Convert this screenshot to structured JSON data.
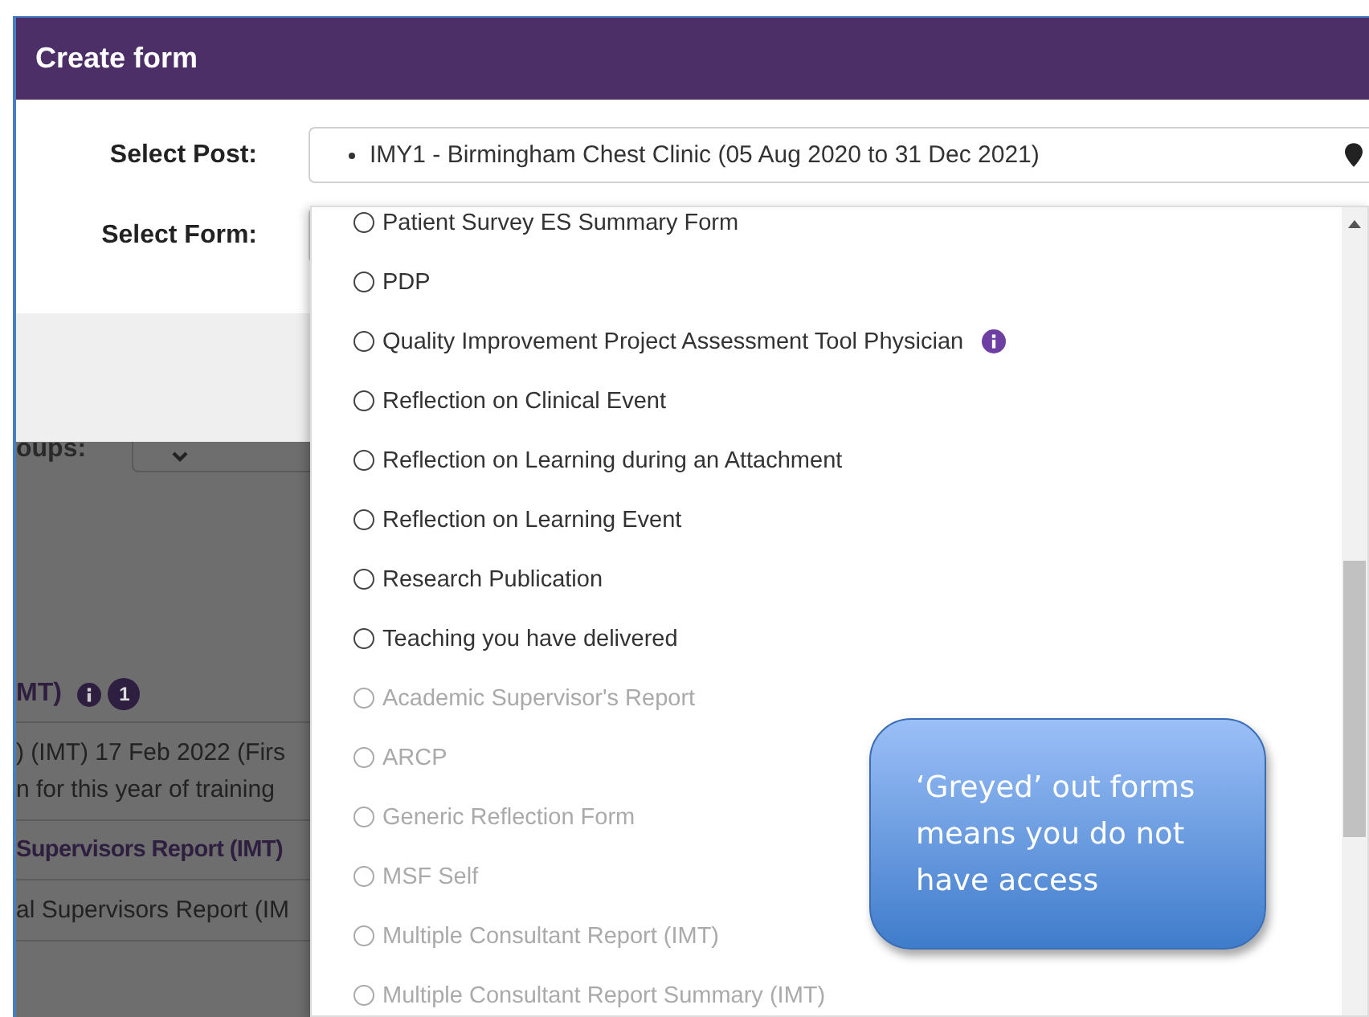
{
  "dialog": {
    "title": "Create form",
    "post_field": {
      "label": "Select Post:",
      "value": "IMY1 - Birmingham Chest Clinic (05 Aug 2020 to 31 Dec 2021)"
    },
    "form_field": {
      "label": "Select Form:"
    }
  },
  "form_options": [
    {
      "label": "Patient Survey ES Summary Form",
      "disabled": false,
      "selected": false,
      "info": false
    },
    {
      "label": "PDP",
      "disabled": false,
      "selected": false,
      "info": false
    },
    {
      "label": "Quality Improvement Project Assessment Tool Physician",
      "disabled": false,
      "selected": false,
      "info": true
    },
    {
      "label": "Reflection on Clinical Event",
      "disabled": false,
      "selected": false,
      "info": false
    },
    {
      "label": "Reflection on Learning during an Attachment",
      "disabled": false,
      "selected": false,
      "info": false
    },
    {
      "label": "Reflection on Learning Event",
      "disabled": false,
      "selected": false,
      "info": false
    },
    {
      "label": "Research Publication",
      "disabled": false,
      "selected": false,
      "info": false
    },
    {
      "label": "Teaching you have delivered",
      "disabled": false,
      "selected": false,
      "info": false
    },
    {
      "label": "Academic Supervisor's Report",
      "disabled": true,
      "selected": false,
      "info": false
    },
    {
      "label": "ARCP",
      "disabled": true,
      "selected": false,
      "info": false
    },
    {
      "label": "Generic Reflection Form",
      "disabled": true,
      "selected": false,
      "info": false
    },
    {
      "label": "MSF Self",
      "disabled": true,
      "selected": false,
      "info": false
    },
    {
      "label": "Multiple Consultant Report (IMT)",
      "disabled": true,
      "selected": false,
      "info": false
    },
    {
      "label": "Multiple Consultant Report Summary (IMT)",
      "disabled": true,
      "selected": false,
      "info": false
    }
  ],
  "callout": {
    "text": "‘Greyed’ out forms means you do not have access"
  },
  "background_page": {
    "groups_label": "oups:",
    "heading": "MT)",
    "badge": "1",
    "rows": [
      {
        "kind": "plain",
        "lines": [
          ") (IMT) 17 Feb 2022 (Firs",
          "n for this year of training"
        ]
      },
      {
        "kind": "link",
        "lines": [
          "Supervisors Report (IMT)"
        ]
      },
      {
        "kind": "plain",
        "lines": [
          "al Supervisors Report (IM"
        ]
      }
    ]
  }
}
